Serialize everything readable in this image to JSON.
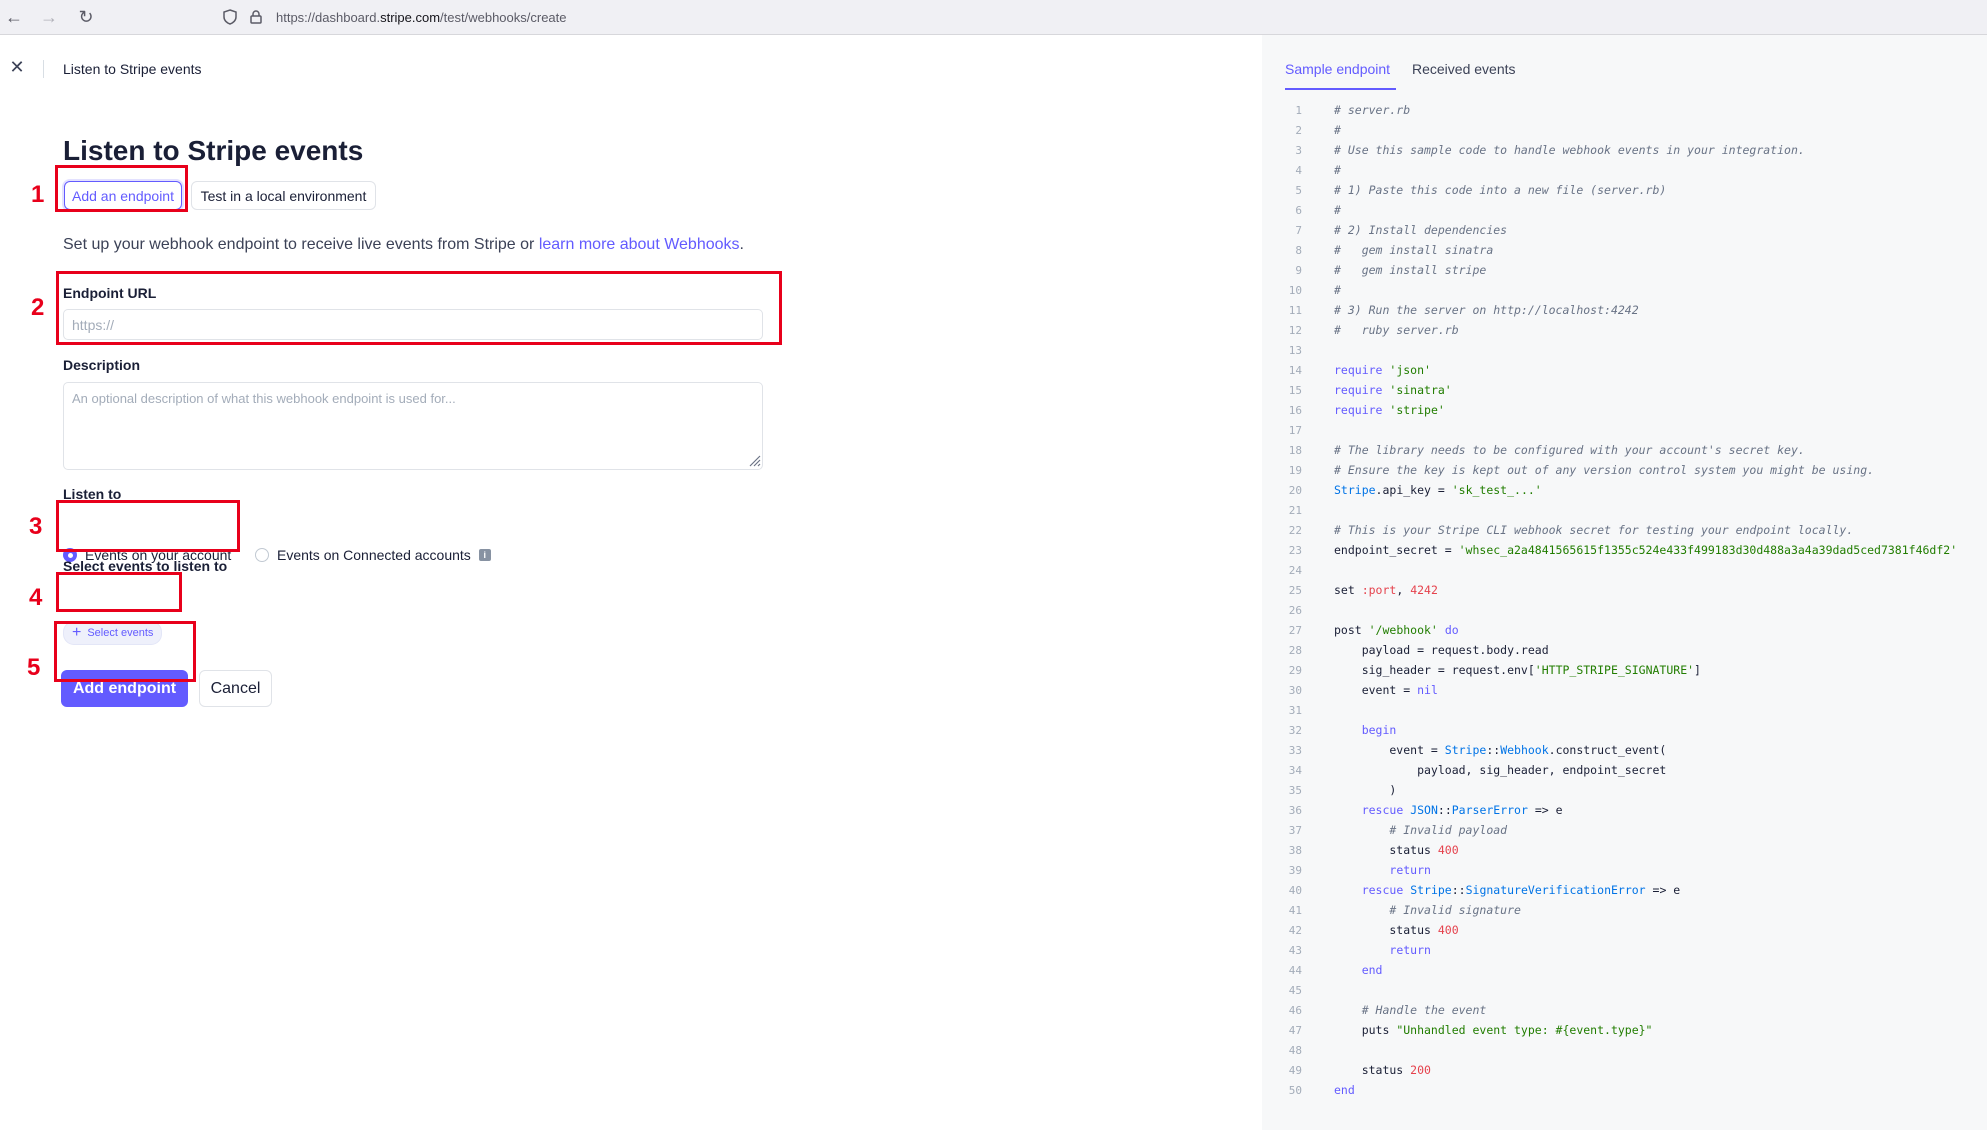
{
  "browser": {
    "url_prefix": "https://dashboard.",
    "url_domain": "stripe.com",
    "url_path": "/test/webhooks/create"
  },
  "topbar": {
    "title": "Listen to Stripe events"
  },
  "form": {
    "heading": "Listen to Stripe events",
    "tab_add": "Add an endpoint",
    "tab_local": "Test in a local environment",
    "intro_text": "Set up your webhook endpoint to receive live events from Stripe or ",
    "intro_link": "learn more about Webhooks",
    "intro_end": ".",
    "endpoint_label": "Endpoint URL",
    "endpoint_placeholder": "https://",
    "description_label": "Description",
    "description_placeholder": "An optional description of what this webhook endpoint is used for...",
    "listen_to_label": "Listen to",
    "radio_account": "Events on your account",
    "radio_connected": "Events on Connected accounts",
    "select_events_label": "Select events to listen to",
    "select_events_button": "Select events",
    "submit_button": "Add endpoint",
    "cancel_button": "Cancel"
  },
  "annotations": [
    "1",
    "2",
    "3",
    "4",
    "5"
  ],
  "annotation_color": "#e8001b",
  "accent_color": "#635bff",
  "right_panel": {
    "tab_sample": "Sample endpoint",
    "tab_received": "Received events",
    "code_lines": [
      [
        [
          "c-cm",
          "# server.rb"
        ]
      ],
      [
        [
          "c-cm",
          "#"
        ]
      ],
      [
        [
          "c-cm",
          "# Use this sample code to handle webhook events in your integration."
        ]
      ],
      [
        [
          "c-cm",
          "#"
        ]
      ],
      [
        [
          "c-cm",
          "# 1) Paste this code into a new file (server.rb)"
        ]
      ],
      [
        [
          "c-cm",
          "#"
        ]
      ],
      [
        [
          "c-cm",
          "# 2) Install dependencies"
        ]
      ],
      [
        [
          "c-cm",
          "#   gem install sinatra"
        ]
      ],
      [
        [
          "c-cm",
          "#   gem install stripe"
        ]
      ],
      [
        [
          "c-cm",
          "#"
        ]
      ],
      [
        [
          "c-cm",
          "# 3) Run the server on http://localhost:4242"
        ]
      ],
      [
        [
          "c-cm",
          "#   ruby server.rb"
        ]
      ],
      [],
      [
        [
          "c-kw",
          "require"
        ],
        [
          "ct",
          " "
        ],
        [
          "c-str",
          "'json'"
        ]
      ],
      [
        [
          "c-kw",
          "require"
        ],
        [
          "ct",
          " "
        ],
        [
          "c-str",
          "'sinatra'"
        ]
      ],
      [
        [
          "c-kw",
          "require"
        ],
        [
          "ct",
          " "
        ],
        [
          "c-str",
          "'stripe'"
        ]
      ],
      [],
      [
        [
          "c-cm",
          "# The library needs to be configured with your account's secret key."
        ]
      ],
      [
        [
          "c-cm",
          "# Ensure the key is kept out of any version control system you might be using."
        ]
      ],
      [
        [
          "c-cls",
          "Stripe"
        ],
        [
          "ct",
          ".api_key = "
        ],
        [
          "c-str",
          "'sk_test_...'"
        ]
      ],
      [],
      [
        [
          "c-cm",
          "# This is your Stripe CLI webhook secret for testing your endpoint locally."
        ]
      ],
      [
        [
          "ct",
          "endpoint_secret = "
        ],
        [
          "c-str",
          "'whsec_a2a4841565615f1355c524e433f499183d30d488a3a4a39dad5ced7381f46df2'"
        ]
      ],
      [],
      [
        [
          "ct",
          "set "
        ],
        [
          "c-sym",
          ":port"
        ],
        [
          "ct",
          ", "
        ],
        [
          "c-num",
          "4242"
        ]
      ],
      [],
      [
        [
          "ct",
          "post "
        ],
        [
          "c-str",
          "'/webhook'"
        ],
        [
          "ct",
          " "
        ],
        [
          "c-kw",
          "do"
        ]
      ],
      [
        [
          "ct",
          "    payload = request.body.read"
        ]
      ],
      [
        [
          "ct",
          "    sig_header = request.env["
        ],
        [
          "c-str",
          "'HTTP_STRIPE_SIGNATURE'"
        ],
        [
          "ct",
          "]"
        ]
      ],
      [
        [
          "ct",
          "    event = "
        ],
        [
          "c-kw",
          "nil"
        ]
      ],
      [],
      [
        [
          "ct",
          "    "
        ],
        [
          "c-kw",
          "begin"
        ]
      ],
      [
        [
          "ct",
          "        event = "
        ],
        [
          "c-cls",
          "Stripe"
        ],
        [
          "ct",
          "::"
        ],
        [
          "c-cls",
          "Webhook"
        ],
        [
          "ct",
          ".construct_event("
        ]
      ],
      [
        [
          "ct",
          "            payload, sig_header, endpoint_secret"
        ]
      ],
      [
        [
          "ct",
          "        )"
        ]
      ],
      [
        [
          "ct",
          "    "
        ],
        [
          "c-kw",
          "rescue"
        ],
        [
          "ct",
          " "
        ],
        [
          "c-cls",
          "JSON"
        ],
        [
          "ct",
          "::"
        ],
        [
          "c-cls",
          "ParserError"
        ],
        [
          "ct",
          " => e"
        ]
      ],
      [
        [
          "ct",
          "        "
        ],
        [
          "c-cm",
          "# Invalid payload"
        ]
      ],
      [
        [
          "ct",
          "        status "
        ],
        [
          "c-num",
          "400"
        ]
      ],
      [
        [
          "ct",
          "        "
        ],
        [
          "c-kw",
          "return"
        ]
      ],
      [
        [
          "ct",
          "    "
        ],
        [
          "c-kw",
          "rescue"
        ],
        [
          "ct",
          " "
        ],
        [
          "c-cls",
          "Stripe"
        ],
        [
          "ct",
          "::"
        ],
        [
          "c-cls",
          "SignatureVerificationError"
        ],
        [
          "ct",
          " => e"
        ]
      ],
      [
        [
          "ct",
          "        "
        ],
        [
          "c-cm",
          "# Invalid signature"
        ]
      ],
      [
        [
          "ct",
          "        status "
        ],
        [
          "c-num",
          "400"
        ]
      ],
      [
        [
          "ct",
          "        "
        ],
        [
          "c-kw",
          "return"
        ]
      ],
      [
        [
          "ct",
          "    "
        ],
        [
          "c-kw",
          "end"
        ]
      ],
      [],
      [
        [
          "ct",
          "    "
        ],
        [
          "c-cm",
          "# Handle the event"
        ]
      ],
      [
        [
          "ct",
          "    puts "
        ],
        [
          "c-str",
          "\"Unhandled event type: #{event.type}\""
        ]
      ],
      [],
      [
        [
          "ct",
          "    status "
        ],
        [
          "c-num",
          "200"
        ]
      ],
      [
        [
          "c-kw",
          "end"
        ]
      ]
    ]
  }
}
